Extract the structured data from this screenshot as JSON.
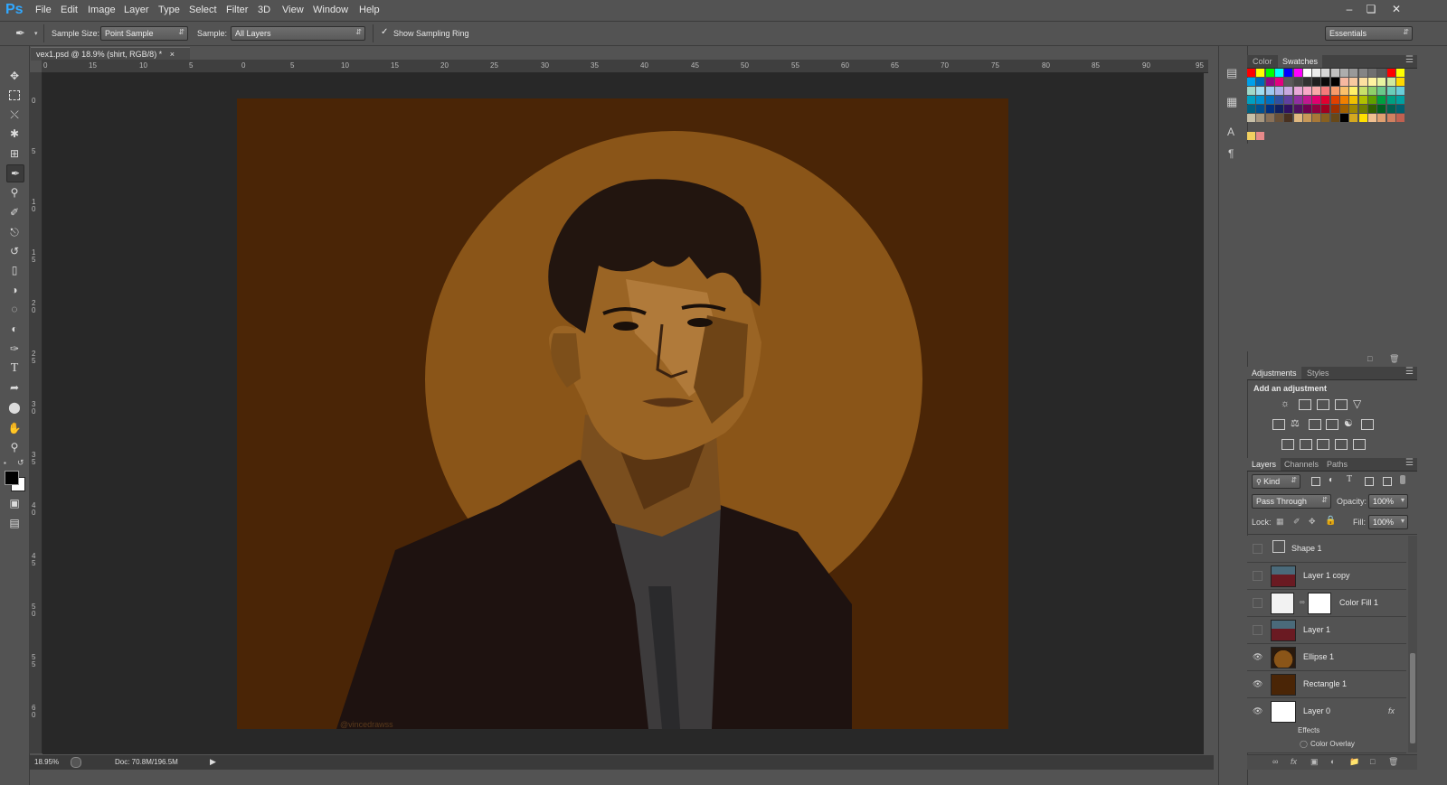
{
  "app": {
    "logo": "Ps"
  },
  "menu": [
    "File",
    "Edit",
    "Image",
    "Layer",
    "Type",
    "Select",
    "Filter",
    "3D",
    "View",
    "Window",
    "Help"
  ],
  "options": {
    "sample_size_label": "Sample Size:",
    "sample_size_value": "Point Sample",
    "sample_label": "Sample:",
    "sample_value": "All Layers",
    "show_sampling_ring_label": "Show Sampling Ring",
    "show_sampling_ring_checked": true,
    "workspace_value": "Essentials"
  },
  "document": {
    "tab_title": "vex1.psd @ 18.9% (shirt, RGB/8) *",
    "close_glyph": "×",
    "watermark": "@vincedrawss"
  },
  "rulers": {
    "horizontal": [
      "0",
      "15",
      "10",
      "5",
      "0",
      "5",
      "10",
      "15",
      "20",
      "25",
      "30",
      "35",
      "40",
      "45",
      "50",
      "55",
      "60",
      "65",
      "70",
      "75",
      "80",
      "85",
      "90",
      "95"
    ],
    "vertical": [
      "0",
      "5",
      "1\n0",
      "1\n5",
      "2\n0",
      "2\n5",
      "3\n0",
      "3\n5",
      "4\n0",
      "4\n5",
      "5\n0",
      "5\n5",
      "6\n0"
    ]
  },
  "status": {
    "zoom": "18.95%",
    "doc": "Doc: 70.8M/196.5M"
  },
  "color_panel": {
    "tabs": [
      "Color",
      "Swatches"
    ],
    "active": "Swatches"
  },
  "adjustments_panel": {
    "tabs": [
      "Adjustments",
      "Styles"
    ],
    "active": "Adjustments",
    "heading": "Add an adjustment"
  },
  "layers_panel": {
    "tabs": [
      "Layers",
      "Channels",
      "Paths"
    ],
    "active": "Layers",
    "filter_kind": "Kind",
    "blend_mode": "Pass Through",
    "opacity_label": "Opacity:",
    "opacity_value": "100%",
    "lock_label": "Lock:",
    "fill_label": "Fill:",
    "fill_value": "100%",
    "layers": [
      {
        "name": "Shape 1",
        "visible": false
      },
      {
        "name": "Layer 1 copy",
        "visible": false
      },
      {
        "name": "Color Fill 1",
        "visible": false
      },
      {
        "name": "Layer 1",
        "visible": false
      },
      {
        "name": "Ellipse 1",
        "visible": true
      },
      {
        "name": "Rectangle 1",
        "visible": true
      },
      {
        "name": "Layer 0",
        "visible": true
      }
    ],
    "effects_label": "Effects",
    "effect_item": "Color Overlay",
    "fx_glyph": "fx"
  },
  "colors": {
    "ui_bg": "#535353",
    "canvas_bg": "#4a2506",
    "halo": "#8a5518",
    "accent": "#31a8ff"
  },
  "icons": [
    "eyedropper-icon",
    "move-icon",
    "marquee-icon",
    "lasso-icon",
    "quick-select-icon",
    "crop-icon",
    "healing-icon",
    "brush-icon",
    "stamp-icon",
    "history-brush-icon",
    "eraser-icon",
    "bucket-icon",
    "blur-icon",
    "dodge-icon",
    "pen-icon",
    "type-icon",
    "path-select-icon",
    "ellipse-icon",
    "hand-icon",
    "zoom-icon"
  ]
}
